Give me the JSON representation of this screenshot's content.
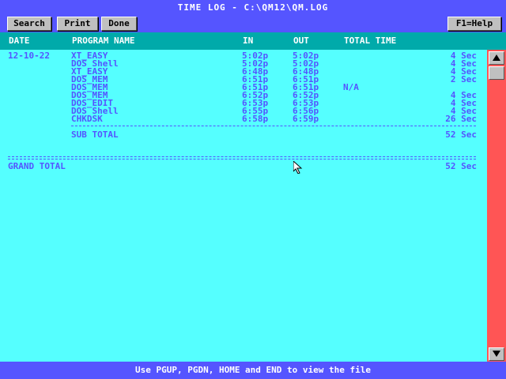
{
  "window": {
    "title": "TIME LOG - C:\\QM12\\QM.LOG"
  },
  "toolbar": {
    "search_label": "Search",
    "print_label": "Print",
    "done_label": "Done",
    "help_label": "F1=Help"
  },
  "columns": {
    "date": "DATE",
    "program": "PROGRAM NAME",
    "in": "IN",
    "out": "OUT",
    "total": "TOTAL TIME"
  },
  "log": {
    "date": "12-10-22",
    "rows": [
      {
        "program": "XT_EASY",
        "in": "5:02p",
        "out": "5:02p",
        "note": "",
        "total": "4 Sec"
      },
      {
        "program": "DOS Shell",
        "in": "5:02p",
        "out": "5:02p",
        "note": "",
        "total": "4 Sec"
      },
      {
        "program": "XT_EASY",
        "in": "6:48p",
        "out": "6:48p",
        "note": "",
        "total": "4 Sec"
      },
      {
        "program": "DOS_MEM",
        "in": "6:51p",
        "out": "6:51p",
        "note": "",
        "total": "2 Sec"
      },
      {
        "program": "DOS_MEM",
        "in": "6:51p",
        "out": "6:51p",
        "note": "N/A",
        "total": ""
      },
      {
        "program": "DOS_MEM",
        "in": "6:52p",
        "out": "6:52p",
        "note": "",
        "total": "4 Sec"
      },
      {
        "program": "DOS_EDIT",
        "in": "6:53p",
        "out": "6:53p",
        "note": "",
        "total": "4 Sec"
      },
      {
        "program": "DOS Shell",
        "in": "6:55p",
        "out": "6:56p",
        "note": "",
        "total": "4 Sec"
      },
      {
        "program": "CHKDSK",
        "in": "6:58p",
        "out": "6:59p",
        "note": "",
        "total": "26 Sec"
      }
    ],
    "subtotal_label": "SUB TOTAL",
    "subtotal_value": "52 Sec",
    "grand_total_label": "GRAND TOTAL",
    "grand_total_value": "52 Sec"
  },
  "scrollbar": {
    "up_icon": "arrow-up-icon",
    "down_icon": "arrow-down-icon"
  },
  "status": {
    "text": "Use PGUP, PGDN, HOME and END to view the file"
  },
  "colors": {
    "title_bar": "#5555ff",
    "header_bar": "#00aaaa",
    "content_bg": "#55ffff",
    "text": "#5555ff",
    "scrollbar": "#ff5555"
  }
}
